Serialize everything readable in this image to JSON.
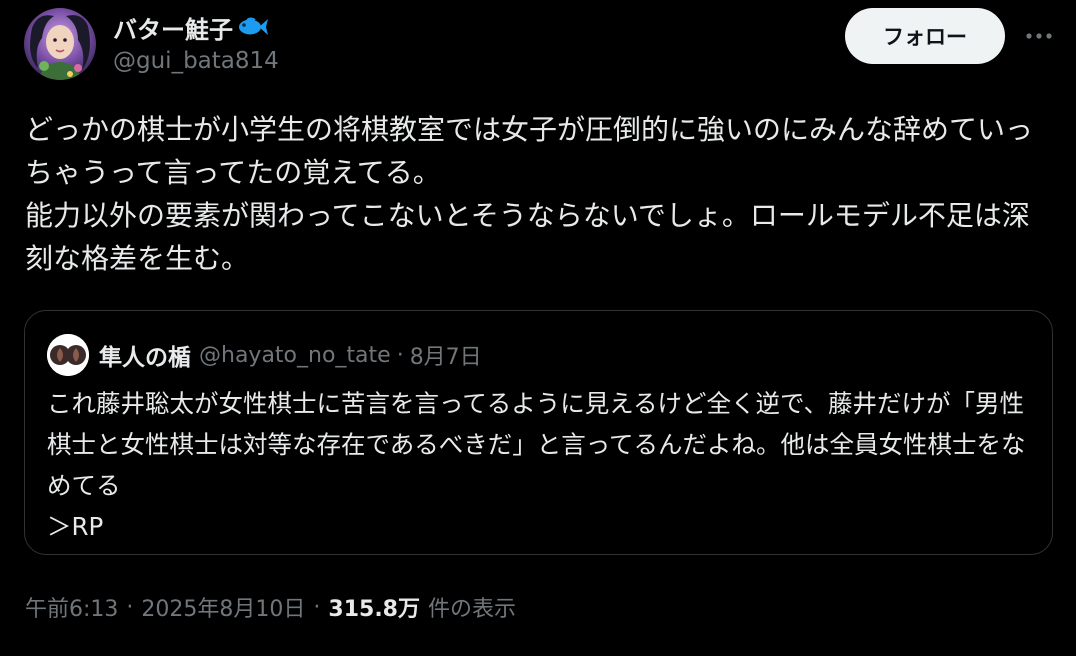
{
  "author": {
    "display_name": "バター鮭子",
    "handle": "@gui_bata814",
    "avatar": "avatar-image",
    "badge_icon": "fish-icon"
  },
  "actions": {
    "follow_label": "フォロー",
    "more_icon": "more-icon"
  },
  "tweet": {
    "text": "どっかの棋士が小学生の将棋教室では女子が圧倒的に強いのにみんな辞めていっちゃうって言ってたの覚えてる。\n能力以外の要素が関わってこないとそうならないでしょ。ロールモデル不足は深刻な格差を生む。"
  },
  "quote": {
    "name": "隼人の楯",
    "handle": "@hayato_no_tate",
    "separator": "·",
    "date": "8月7日",
    "text": "これ藤井聡太が女性棋士に苦言を言ってるように見えるけど全く逆で、藤井だけが「男性棋士と女性棋士は対等な存在であるべきだ」と言ってるんだよね。他は全員女性棋士をなめてる\n＞RP"
  },
  "meta": {
    "time": "午前6:13",
    "separator": "·",
    "date": "2025年8月10日",
    "views_count": "315.8万",
    "views_label": "件の表示"
  },
  "colors": {
    "background": "#000000",
    "text_primary": "#e7e9ea",
    "text_secondary": "#71767b",
    "border": "#2f3336",
    "follow_bg": "#eff3f4",
    "follow_text": "#0f1419",
    "fish_blue": "#1d9bf0"
  }
}
